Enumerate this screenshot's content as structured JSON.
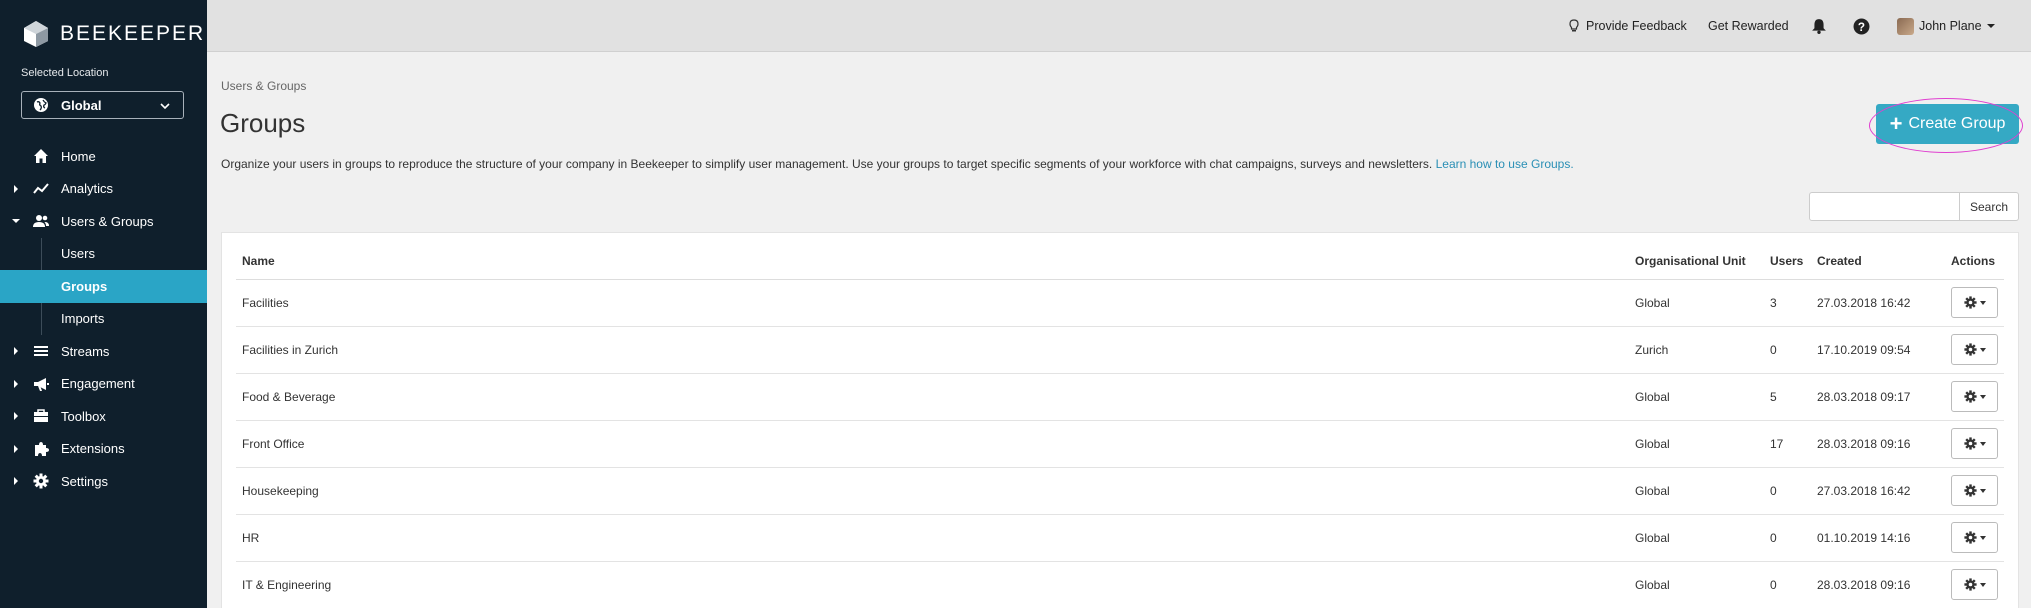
{
  "sidebar": {
    "logo_text": "BEEKEEPER",
    "location_label": "Selected Location",
    "location_value": "Global",
    "nav": [
      {
        "label": "Home",
        "icon": "home-icon"
      },
      {
        "label": "Analytics",
        "icon": "analytics-icon"
      },
      {
        "label": "Users & Groups",
        "icon": "users-icon"
      },
      {
        "label": "Users"
      },
      {
        "label": "Groups"
      },
      {
        "label": "Imports"
      },
      {
        "label": "Streams",
        "icon": "streams-icon"
      },
      {
        "label": "Engagement",
        "icon": "megaphone-icon"
      },
      {
        "label": "Toolbox",
        "icon": "toolbox-icon"
      },
      {
        "label": "Extensions",
        "icon": "puzzle-icon"
      },
      {
        "label": "Settings",
        "icon": "gear-icon"
      }
    ]
  },
  "topbar": {
    "feedback": "Provide Feedback",
    "rewarded": "Get Rewarded",
    "user_name": "John Plane"
  },
  "main": {
    "breadcrumb": "Users & Groups",
    "title": "Groups",
    "description": "Organize your users in groups to reproduce the structure of your company in Beekeeper to simplify user management. Use your groups to target specific segments of your workforce with chat campaigns, surveys and newsletters.",
    "learn_link": "Learn how to use Groups.",
    "create_button": "Create Group",
    "search_button": "Search",
    "search_value": ""
  },
  "table": {
    "columns": [
      "Name",
      "Organisational Unit",
      "Users",
      "Created",
      "Actions"
    ],
    "rows": [
      {
        "name": "Facilities",
        "unit": "Global",
        "users": "3",
        "created": "27.03.2018 16:42"
      },
      {
        "name": "Facilities in Zurich",
        "unit": "Zurich",
        "users": "0",
        "created": "17.10.2019 09:54"
      },
      {
        "name": "Food & Beverage",
        "unit": "Global",
        "users": "5",
        "created": "28.03.2018 09:17"
      },
      {
        "name": "Front Office",
        "unit": "Global",
        "users": "17",
        "created": "28.03.2018 09:16"
      },
      {
        "name": "Housekeeping",
        "unit": "Global",
        "users": "0",
        "created": "27.03.2018 16:42"
      },
      {
        "name": "HR",
        "unit": "Global",
        "users": "0",
        "created": "01.10.2019 14:16"
      },
      {
        "name": "IT & Engineering",
        "unit": "Global",
        "users": "0",
        "created": "28.03.2018 09:16"
      }
    ]
  },
  "colors": {
    "sidebar_bg": "#0f1f2c",
    "accent": "#2aa5c6",
    "highlight": "#e040d0"
  }
}
